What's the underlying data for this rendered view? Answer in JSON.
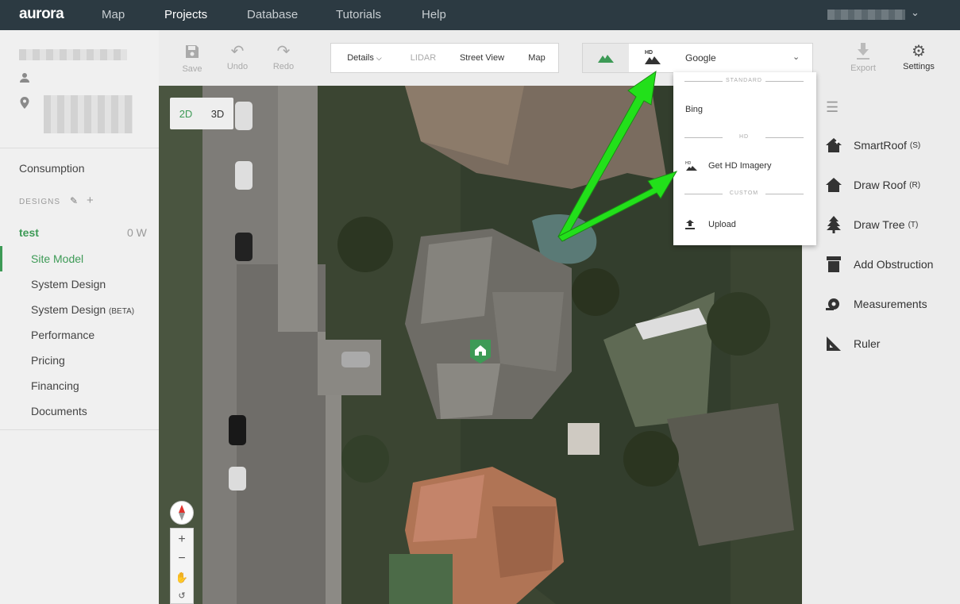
{
  "nav": {
    "logo": "aurora",
    "items": [
      "Map",
      "Projects",
      "Database",
      "Tutorials",
      "Help"
    ],
    "active": "Projects"
  },
  "sidebar": {
    "consumption": "Consumption",
    "designs_label": "DESIGNS",
    "design": {
      "name": "test",
      "watts": "0 W"
    },
    "items": [
      {
        "label": "Site Model"
      },
      {
        "label": "System Design"
      },
      {
        "label": "System Design",
        "badge": "(BETA)"
      },
      {
        "label": "Performance"
      },
      {
        "label": "Pricing"
      },
      {
        "label": "Financing"
      },
      {
        "label": "Documents"
      }
    ]
  },
  "toolbar": {
    "save": "Save",
    "undo": "Undo",
    "redo": "Redo",
    "view_tabs": [
      "Details",
      "LIDAR",
      "Street View",
      "Map"
    ],
    "imagery_provider": "Google",
    "hd_badge": "HD",
    "export": "Export",
    "settings": "Settings"
  },
  "dropdown": {
    "standard_label": "STANDARD",
    "bing": "Bing",
    "hd_label": "HD",
    "hd_badge": "HD",
    "get_hd": "Get HD Imagery",
    "custom_label": "CUSTOM",
    "upload": "Upload"
  },
  "map": {
    "btn_2d": "2D",
    "btn_3d": "3D",
    "active_mode": "2D"
  },
  "right_panel": {
    "tools": [
      {
        "label": "SmartRoof",
        "key": "(S)",
        "icon": "smartroof-icon"
      },
      {
        "label": "Draw Roof",
        "key": "(R)",
        "icon": "roof-icon"
      },
      {
        "label": "Draw Tree",
        "key": "(T)",
        "icon": "tree-icon"
      },
      {
        "label": "Add Obstruction",
        "key": "",
        "icon": "obstruction-icon"
      },
      {
        "label": "Measurements",
        "key": "",
        "icon": "tape-measure-icon"
      },
      {
        "label": "Ruler",
        "key": "",
        "icon": "ruler-icon"
      }
    ]
  },
  "colors": {
    "brand_green": "#3d9a56",
    "nav_bg": "#2c3a42",
    "arrow_green": "#22e01a"
  }
}
